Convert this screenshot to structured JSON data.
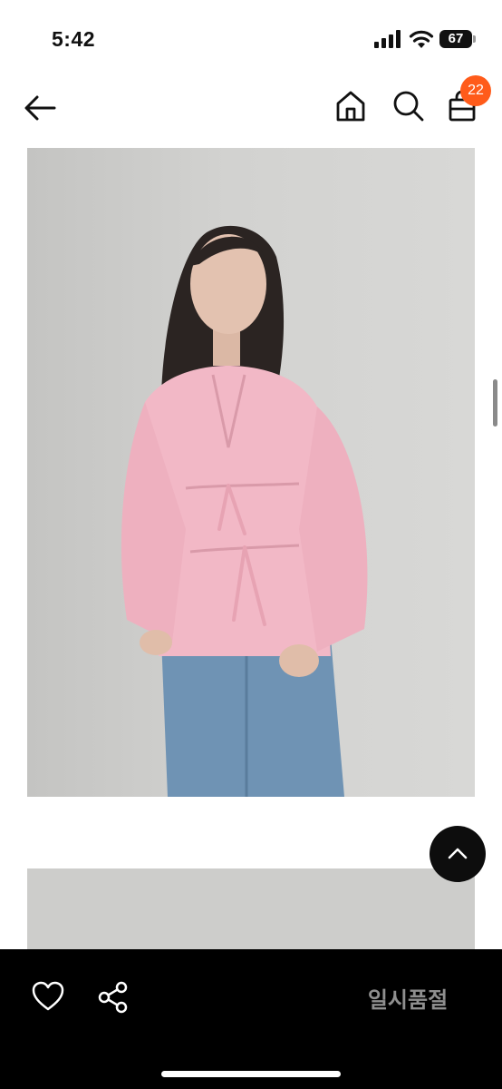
{
  "status_bar": {
    "time": "5:42",
    "battery_level": "67"
  },
  "nav": {
    "back_icon": "arrow-left-icon",
    "home_icon": "home-icon",
    "search_icon": "search-icon",
    "cart_icon": "shopping-bag-icon",
    "cart_count": "22"
  },
  "colors": {
    "badge": "#ff5b1a",
    "bottom_bar": "#000000",
    "sold_out_text": "#8f8f8f"
  },
  "bottom_bar": {
    "like_icon": "heart-icon",
    "share_icon": "share-icon",
    "sold_out_label": "일시품절"
  },
  "scroll_top_icon": "chevron-up-icon"
}
